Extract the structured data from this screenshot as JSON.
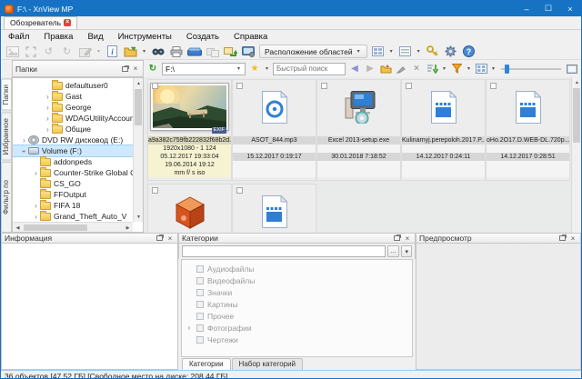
{
  "window": {
    "title": "F:\\ - XnView MP",
    "controls": {
      "minimize": "–",
      "maximize": "☐",
      "close": "×"
    }
  },
  "tabs": {
    "browser_tab": "Обозреватель"
  },
  "menu": {
    "items": [
      "Файл",
      "Правка",
      "Вид",
      "Инструменты",
      "Создать",
      "Справка"
    ]
  },
  "toolbar": {
    "layout_areas": "Расположение областей"
  },
  "addressbar": {
    "path": "F:\\",
    "search_placeholder": "Быстрый поиск"
  },
  "icons": {
    "dropdown": "▾",
    "chevron": "›",
    "rotate_left": "↺",
    "rotate_right": "↻",
    "star": "★",
    "back": "◀",
    "forward": "▶",
    "up": "▲",
    "down": "▼",
    "left": "◀",
    "right": "▶",
    "close": "×",
    "help": "?",
    "refresh": "↻",
    "more": "..."
  },
  "sidebar": {
    "tabs": [
      "Папки",
      "Избранное",
      "Фильтр по категориям"
    ],
    "folders_title": "Папки",
    "tree": [
      {
        "label": "defaultuser0"
      },
      {
        "label": "Gast"
      },
      {
        "label": "George"
      },
      {
        "label": "WDAGUtilityAccount"
      },
      {
        "label": "Общие"
      },
      {
        "label": "DVD RW дисковод (E:)"
      },
      {
        "label": "Volume (F:)"
      },
      {
        "label": "addonpeds"
      },
      {
        "label": "Counter-Strike Global Of"
      },
      {
        "label": "CS_GO"
      },
      {
        "label": "FFOutput"
      },
      {
        "label": "FIFA 18"
      },
      {
        "label": "Grand_Theft_Auto_V"
      }
    ]
  },
  "files": [
    {
      "name": "a9a382c759fb222832f68b2d...",
      "type": "image",
      "badge": "EXIF",
      "line1": "1920x1080 - 1 124",
      "line2": "05.12.2017 19:33:04",
      "line3": "19.06.2014 19:12",
      "line4": "mm f/ s iso"
    },
    {
      "name": "ASOT_844.mp3",
      "type": "audio",
      "date": "15.12.2017 0:19:17"
    },
    {
      "name": "Excel 2013-setup.exe",
      "type": "executable",
      "date": "30.01.2018 7:18:52"
    },
    {
      "name": "Kulinarnyj.perepoloh.2017.P...",
      "type": "video",
      "date": "14.12.2017 0:24:11"
    },
    {
      "name": "oHo.2O17.D.WEB-DL.720p...",
      "type": "video",
      "date": "14.12.2017 0:28:51"
    }
  ],
  "panels": {
    "info": {
      "title": "Информация"
    },
    "categories": {
      "title": "Категории",
      "items": [
        "Аудиофайлы",
        "Видеофайлы",
        "Значки",
        "Картины",
        "Прочее",
        "Фотографии",
        "Чертежи"
      ],
      "tabs": [
        "Категории",
        "Набор категорий"
      ]
    },
    "preview": {
      "title": "Предпросмотр"
    }
  },
  "statusbar": {
    "text": "36 объектов [47.52 ГБ] [Свободное место на диске: 208.44 ГБ]"
  }
}
